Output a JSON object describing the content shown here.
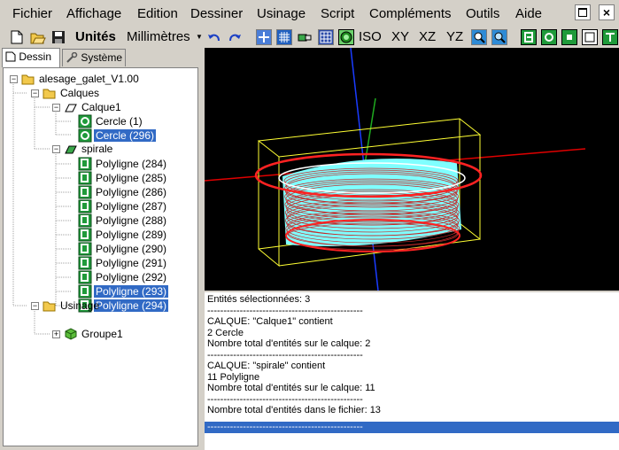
{
  "menu": [
    "Fichier",
    "Affichage",
    "Edition",
    "Dessiner",
    "Usinage",
    "Script",
    "Compléments",
    "Outils",
    "Aide"
  ],
  "toolbar": {
    "units_label": "Unités",
    "units_value": "Millimètres",
    "views": [
      "ISO",
      "XY",
      "XZ",
      "YZ"
    ]
  },
  "tabs": [
    "Dessin",
    "Système"
  ],
  "tree": {
    "root": "alesage_galet_V1.00",
    "layers_folder": "Calques",
    "layer1": "Calque1",
    "circles": [
      "Cercle (1)",
      "Cercle (296)"
    ],
    "layer2": "spirale",
    "polylines": [
      "Polyligne (284)",
      "Polyligne (285)",
      "Polyligne (286)",
      "Polyligne (287)",
      "Polyligne (288)",
      "Polyligne (289)",
      "Polyligne (290)",
      "Polyligne (291)",
      "Polyligne (292)",
      "Polyligne (293)",
      "Polyligne (294)"
    ],
    "machining_folder": "Usinage",
    "group": "Groupe1"
  },
  "console": [
    "Entités sélectionnées: 3",
    "------------------------------------------------",
    "CALQUE: \"Calque1\"  contient",
    "2  Cercle",
    "Nombre total d'entités sur le calque: 2",
    "------------------------------------------------",
    "CALQUE: \"spirale\"  contient",
    "11  Polyligne",
    "Nombre total d'entités sur le calque: 11",
    "------------------------------------------------",
    "Nombre total d'entités dans le fichier: 13",
    "------------------------------------------------"
  ],
  "colors": {
    "selection": "#316ac5",
    "viewport_bg": "#000000",
    "model_fill": "#7fffff",
    "circle": "#ff0000",
    "box": "#ffff00"
  }
}
